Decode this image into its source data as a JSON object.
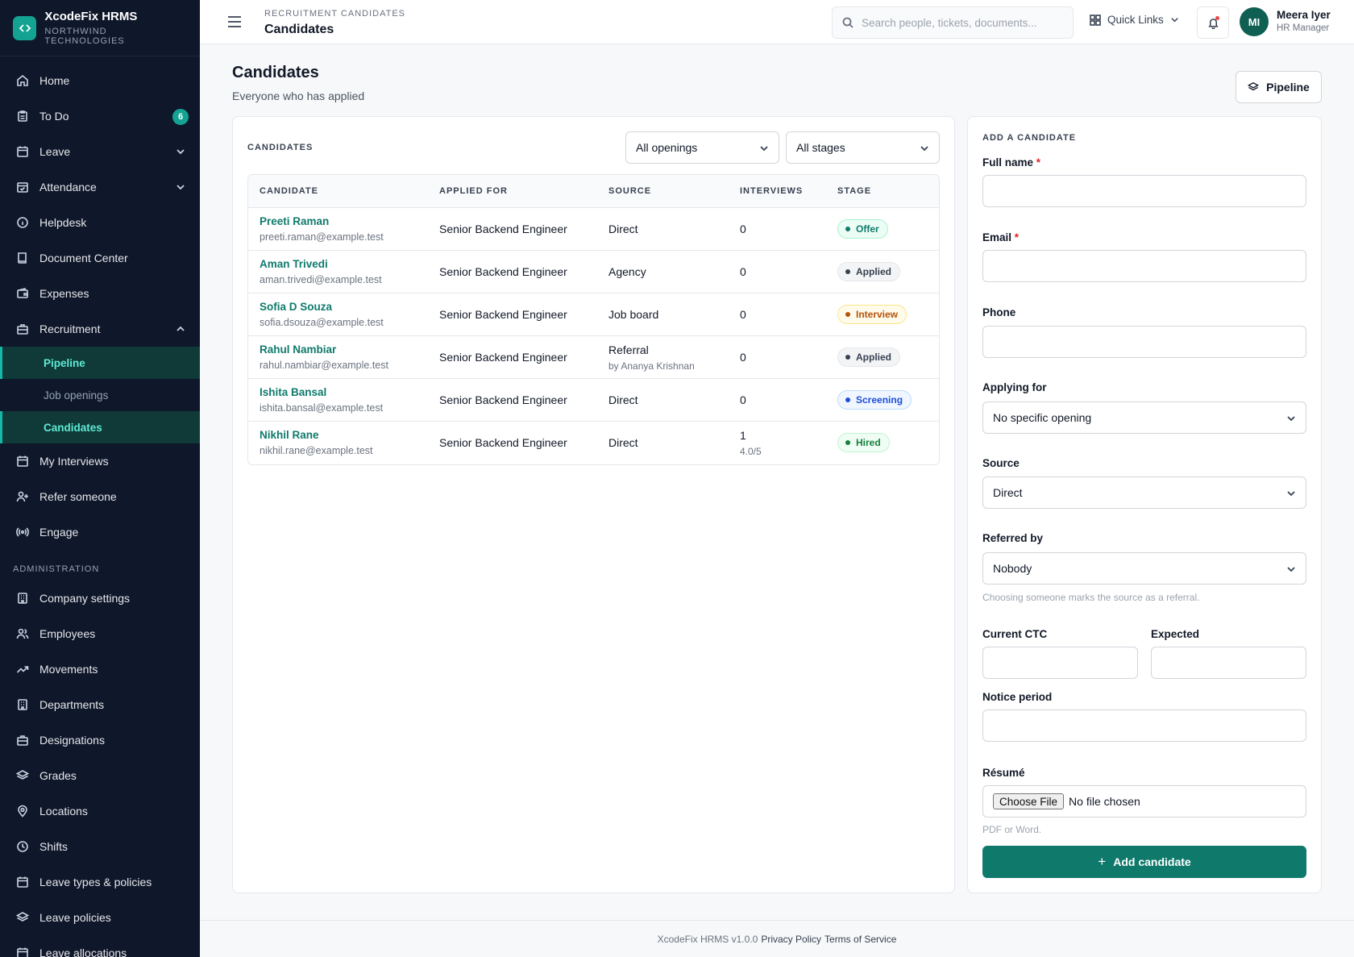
{
  "brand": {
    "name": "XcodeFix HRMS",
    "org": "NORTHWIND TECHNOLOGIES",
    "logo_icon": "code-icon",
    "accent": "#14a392"
  },
  "sidebar": {
    "items": [
      {
        "label": "Home",
        "icon": "home-icon"
      },
      {
        "label": "To Do",
        "icon": "clipboard-icon",
        "badge": "6"
      },
      {
        "label": "Leave",
        "icon": "calendar-icon",
        "expandable": true
      },
      {
        "label": "Attendance",
        "icon": "calendar-check-icon",
        "expandable": true
      },
      {
        "label": "Helpdesk",
        "icon": "info-icon"
      },
      {
        "label": "Document Center",
        "icon": "book-icon"
      },
      {
        "label": "Expenses",
        "icon": "wallet-icon"
      },
      {
        "label": "Recruitment",
        "icon": "briefcase-icon",
        "expanded": true
      }
    ],
    "recruitment_sub": [
      {
        "label": "Pipeline",
        "active": true
      },
      {
        "label": "Job openings",
        "active": false
      },
      {
        "label": "Candidates",
        "active": true
      }
    ],
    "items_after": [
      {
        "label": "My Interviews",
        "icon": "calendar-icon"
      },
      {
        "label": "Refer someone",
        "icon": "user-plus-icon"
      },
      {
        "label": "Engage",
        "icon": "broadcast-icon"
      }
    ],
    "admin_section": "ADMINISTRATION",
    "admin_items": [
      {
        "label": "Company settings",
        "icon": "building-icon"
      },
      {
        "label": "Employees",
        "icon": "users-icon"
      },
      {
        "label": "Movements",
        "icon": "trend-icon"
      },
      {
        "label": "Departments",
        "icon": "building-icon"
      },
      {
        "label": "Designations",
        "icon": "briefcase-icon"
      },
      {
        "label": "Grades",
        "icon": "layers-icon"
      },
      {
        "label": "Locations",
        "icon": "map-pin-icon"
      },
      {
        "label": "Shifts",
        "icon": "clock-icon"
      },
      {
        "label": "Leave types & policies",
        "icon": "calendar-icon"
      },
      {
        "label": "Leave policies",
        "icon": "layers-icon"
      },
      {
        "label": "Leave allocations",
        "icon": "calendar-icon"
      }
    ]
  },
  "header": {
    "crumb": "RECRUITMENT CANDIDATES",
    "title": "Candidates",
    "search_placeholder": "Search people, tickets, documents...",
    "quick_links": "Quick Links",
    "user": {
      "initials": "MI",
      "name": "Meera Iyer",
      "role": "HR Manager"
    }
  },
  "main": {
    "title": "Candidates",
    "subtitle": "Everyone who has applied",
    "pipeline_button": "Pipeline"
  },
  "candidates": {
    "label": "CANDIDATES",
    "filter_openings": "All openings",
    "filter_stages": "All stages",
    "columns": [
      "CANDIDATE",
      "APPLIED FOR",
      "SOURCE",
      "INTERVIEWS",
      "STAGE"
    ],
    "rows": [
      {
        "name": "Preeti Raman",
        "email": "preeti.raman@example.test",
        "applied_for": "Senior Backend Engineer",
        "source": "Direct",
        "source_sub": "",
        "interviews": "0",
        "interviews_sub": "",
        "stage": "Offer",
        "stage_color": "#0f7a6c",
        "stage_bg": "#ecfdf5",
        "stage_border": "#a7f3d0"
      },
      {
        "name": "Aman Trivedi",
        "email": "aman.trivedi@example.test",
        "applied_for": "Senior Backend Engineer",
        "source": "Agency",
        "source_sub": "",
        "interviews": "0",
        "interviews_sub": "",
        "stage": "Applied",
        "stage_color": "#374151",
        "stage_bg": "#f3f4f6",
        "stage_border": "#e5e7eb"
      },
      {
        "name": "Sofia D Souza",
        "email": "sofia.dsouza@example.test",
        "applied_for": "Senior Backend Engineer",
        "source": "Job board",
        "source_sub": "",
        "interviews": "0",
        "interviews_sub": "",
        "stage": "Interview",
        "stage_color": "#b45309",
        "stage_bg": "#fffbeb",
        "stage_border": "#fde68a"
      },
      {
        "name": "Rahul Nambiar",
        "email": "rahul.nambiar@example.test",
        "applied_for": "Senior Backend Engineer",
        "source": "Referral",
        "source_sub": "by Ananya Krishnan",
        "interviews": "0",
        "interviews_sub": "",
        "stage": "Applied",
        "stage_color": "#374151",
        "stage_bg": "#f3f4f6",
        "stage_border": "#e5e7eb"
      },
      {
        "name": "Ishita Bansal",
        "email": "ishita.bansal@example.test",
        "applied_for": "Senior Backend Engineer",
        "source": "Direct",
        "source_sub": "",
        "interviews": "0",
        "interviews_sub": "",
        "stage": "Screening",
        "stage_color": "#1d4ed8",
        "stage_bg": "#eff6ff",
        "stage_border": "#bfdbfe"
      },
      {
        "name": "Nikhil Rane",
        "email": "nikhil.rane@example.test",
        "applied_for": "Senior Backend Engineer",
        "source": "Direct",
        "source_sub": "",
        "interviews": "1",
        "interviews_sub": "4.0/5",
        "stage": "Hired",
        "stage_color": "#15803d",
        "stage_bg": "#f0fdf4",
        "stage_border": "#bbf7d0"
      }
    ]
  },
  "form": {
    "label": "ADD A CANDIDATE",
    "full_name": "Full name",
    "email": "Email",
    "required_mark": "*",
    "phone": "Phone",
    "applying_for": "Applying for",
    "applying_for_value": "No specific opening",
    "source": "Source",
    "source_value": "Direct",
    "referred_by": "Referred by",
    "referred_by_value": "Nobody",
    "referred_help": "Choosing someone marks the source as a referral.",
    "current_ctc": "Current CTC",
    "expected": "Expected",
    "notice_period": "Notice period",
    "resume": "Résumé",
    "file_button": "Choose File",
    "file_status": "No file chosen",
    "resume_help": "PDF or Word.",
    "submit": "Add candidate"
  },
  "footer": {
    "version": "XcodeFix HRMS v1.0.0",
    "privacy": "Privacy Policy",
    "terms": "Terms of Service"
  }
}
